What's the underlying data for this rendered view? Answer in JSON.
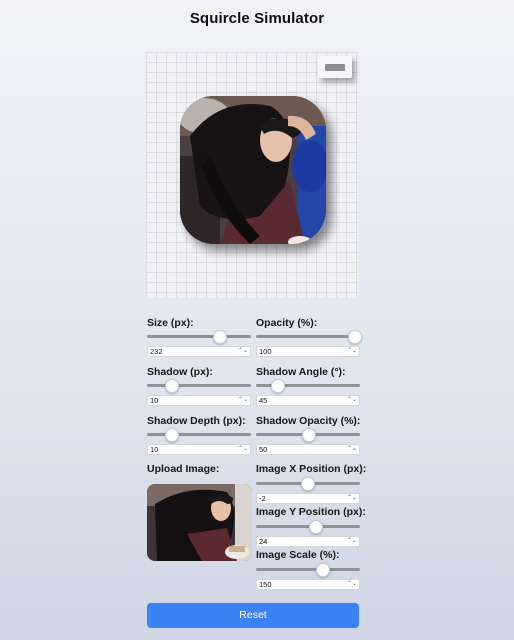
{
  "title": "Squircle Simulator",
  "controls": {
    "size": {
      "label": "Size (px):",
      "value": "232",
      "level": 0.72
    },
    "opacity": {
      "label": "Opacity (%):",
      "value": "100",
      "level": 1.0
    },
    "shadow": {
      "label": "Shadow (px):",
      "value": "10",
      "level": 0.2
    },
    "shadow_angle": {
      "label": "Shadow Angle (°):",
      "value": "45",
      "level": 0.16
    },
    "shadow_depth": {
      "label": "Shadow Depth (px):",
      "value": "10",
      "level": 0.2
    },
    "shadow_opacity": {
      "label": "Shadow Opacity (%):",
      "value": "50",
      "level": 0.5
    },
    "upload": {
      "label": "Upload Image:"
    },
    "image_x": {
      "label": "Image X Position (px):",
      "value": "-2",
      "level": 0.49
    },
    "image_y": {
      "label": "Image Y Position (px):",
      "value": "24",
      "level": 0.58
    },
    "image_scale": {
      "label": "Image Scale (%):",
      "value": "150",
      "level": 0.65
    }
  },
  "spinner_glyph": "⌃⌄",
  "reset_label": "Reset",
  "colors": {
    "accent": "#3b82f6",
    "track": "#8e929a",
    "background": "#e6e9f1"
  }
}
